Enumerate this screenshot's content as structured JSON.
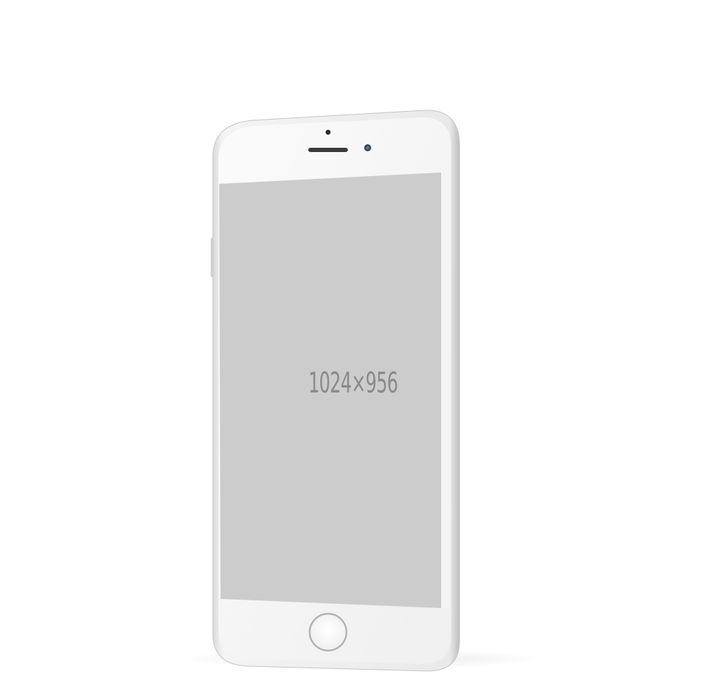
{
  "device": {
    "type": "smartphone mockup",
    "body_color": "#f2f2f2",
    "frame_color": "#d8d8d8",
    "screen_color": "#cccccc"
  },
  "screen": {
    "placeholder_text": "1024×956"
  }
}
